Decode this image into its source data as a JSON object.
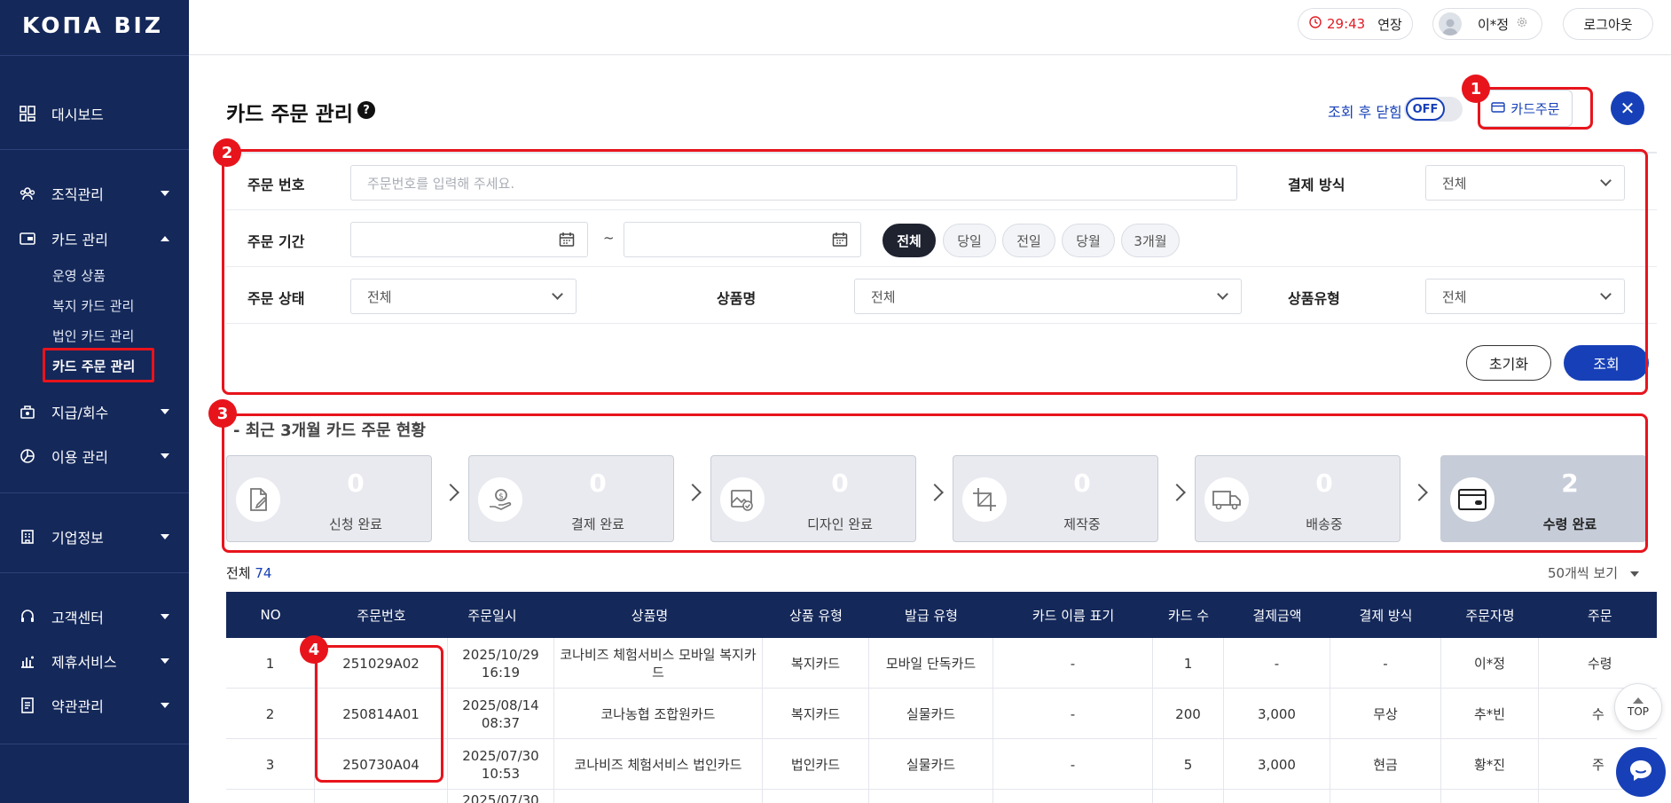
{
  "sidebar": {
    "logo": "KOΠA BIZ",
    "items": [
      {
        "label": "대시보드",
        "icon": "dashboard-icon"
      },
      {
        "label": "조직관리",
        "icon": "organization-icon"
      },
      {
        "label": "카드 관리",
        "icon": "card-icon"
      },
      {
        "label": "지급/회수",
        "icon": "payment-icon"
      },
      {
        "label": "이용 관리",
        "icon": "usage-chart-icon"
      },
      {
        "label": "기업정보",
        "icon": "building-icon"
      },
      {
        "label": "고객센터",
        "icon": "headset-icon"
      },
      {
        "label": "제휴서비스",
        "icon": "partner-icon"
      },
      {
        "label": "약관관리",
        "icon": "document-icon"
      }
    ],
    "card_sub": [
      "운영 상품",
      "복지 카드 관리",
      "법인 카드 관리",
      "카드 주문 관리"
    ]
  },
  "header": {
    "timer": "29:43",
    "extend": "연장",
    "user_name": "이*정",
    "logout": "로그아웃"
  },
  "page": {
    "title": "카드 주문 관리",
    "help": "?",
    "close_after_label": "조회 후 닫힘",
    "toggle_state": "OFF",
    "order_button": "카드주문",
    "close_button": "✕"
  },
  "filter": {
    "order_no_label": "주문 번호",
    "order_no_placeholder": "주문번호를 입력해 주세요.",
    "payment_label": "결제 방식",
    "payment_value": "전체",
    "period_label": "주문 기간",
    "period_sep": "~",
    "period_chips": [
      "전체",
      "당일",
      "전일",
      "당월",
      "3개월"
    ],
    "status_label": "주문 상태",
    "status_value": "전체",
    "product_label": "상품명",
    "product_value": "전체",
    "product_type_label": "상품유형",
    "product_type_value": "전체",
    "reset": "초기화",
    "search": "조회"
  },
  "status": {
    "title": "- 최근 3개월 카드 주문 현황",
    "steps": [
      {
        "count": "0",
        "label": "신청 완료",
        "icon": "application-icon"
      },
      {
        "count": "0",
        "label": "결제 완료",
        "icon": "payment-done-icon"
      },
      {
        "count": "0",
        "label": "디자인 완료",
        "icon": "design-icon"
      },
      {
        "count": "0",
        "label": "제작중",
        "icon": "production-icon"
      },
      {
        "count": "0",
        "label": "배송중",
        "icon": "truck-icon"
      },
      {
        "count": "2",
        "label": "수령 완료",
        "icon": "card-received-icon"
      }
    ]
  },
  "table": {
    "total_label": "전체",
    "total_count": "74",
    "per_page": "50개씩 보기",
    "headers": [
      "NO",
      "주문번호",
      "주문일시",
      "상품명",
      "상품 유형",
      "발급 유형",
      "카드 이름 표기",
      "카드 수",
      "결제금액",
      "결제 방식",
      "주문자명",
      "주문"
    ],
    "rows": [
      [
        "1",
        "251029A02",
        "2025/10/29 16:19",
        "코나비즈 체험서비스 모바일 복지카드",
        "복지카드",
        "모바일 단독카드",
        "-",
        "1",
        "-",
        "-",
        "이*정",
        "수령"
      ],
      [
        "2",
        "250814A01",
        "2025/08/14 08:37",
        "코나농협 조합원카드",
        "복지카드",
        "실물카드",
        "-",
        "200",
        "3,000",
        "무상",
        "추*빈",
        "수"
      ],
      [
        "3",
        "250730A04",
        "2025/07/30 10:53",
        "코나비즈 체험서비스 법인카드",
        "법인카드",
        "실물카드",
        "-",
        "5",
        "3,000",
        "현금",
        "황*진",
        "주"
      ],
      [
        "",
        "",
        "2025/07/30",
        "",
        "",
        "",
        "",
        "",
        "",
        "",
        "",
        ""
      ]
    ]
  },
  "annotations": [
    "1",
    "2",
    "3",
    "4"
  ],
  "floating": {
    "top": "TOP"
  },
  "colors": {
    "navy": "#14285a",
    "accent": "#1740b8",
    "highlight": "#e8141c",
    "timer": "#e31b23"
  }
}
